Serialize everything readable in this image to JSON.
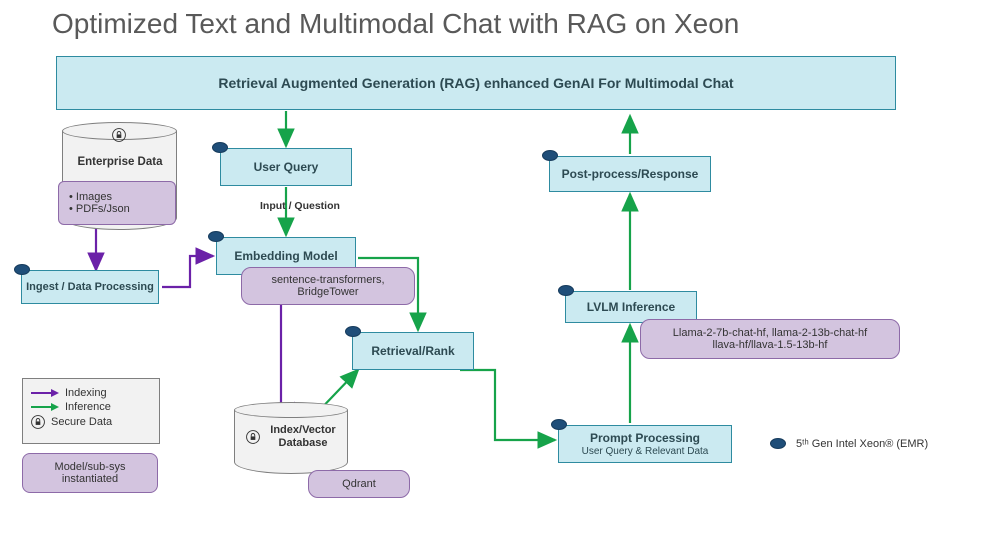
{
  "title": "Optimized Text and Multimodal Chat with RAG on Xeon",
  "boxes": {
    "top": "Retrieval Augmented Generation (RAG) enhanced GenAI For Multimodal Chat",
    "userQuery": "User Query",
    "embedding": "Embedding Model",
    "retrieval": "Retrieval/Rank",
    "prompt": {
      "main": "Prompt Processing",
      "sub": "User Query & Relevant Data"
    },
    "lvlm": "LVLM Inference",
    "postprocess": "Post-process/Response",
    "ingest": "Ingest / Data Processing"
  },
  "pills": {
    "enterpriseList": {
      "line1": "•  Images",
      "line2": "•  PDFs/Json"
    },
    "embedModel": {
      "line1": "sentence-transformers,",
      "line2": "BridgeTower"
    },
    "qdrant": "Qdrant",
    "llm": {
      "line1": "Llama-2-7b-chat-hf, llama-2-13b-chat-hf",
      "line2": "llava-hf/llava-1.5-13b-hf"
    },
    "modelInst": {
      "line1": "Model/sub-sys",
      "line2": "instantiated"
    }
  },
  "labels": {
    "enterprise": "Enterprise Data",
    "inputQuestion": "Input / Question",
    "indexDb": {
      "line1": "Index/Vector",
      "line2": "Database"
    }
  },
  "legend": {
    "indexing": "Indexing",
    "inference": "Inference",
    "secure": "Secure Data"
  },
  "footnote": "5ᵗʰ Gen Intel Xeon® (EMR)"
}
